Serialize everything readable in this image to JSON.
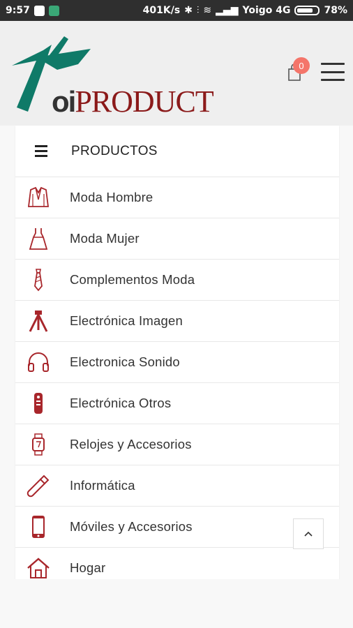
{
  "status_bar": {
    "time": "9:57",
    "net_speed": "401K/s",
    "carrier": "Yoigo 4G",
    "battery": "78%",
    "battery_level": 0.78
  },
  "header": {
    "logo_text_prefix": "oi",
    "logo_text_main": "PRODUCT",
    "cart_count": "0"
  },
  "menu": {
    "title": "PRODUCTOS",
    "items": [
      {
        "label": "Moda Hombre",
        "icon": "suit-jacket-icon"
      },
      {
        "label": "Moda Mujer",
        "icon": "dress-icon"
      },
      {
        "label": "Complementos Moda",
        "icon": "tie-icon"
      },
      {
        "label": "Electrónica Imagen",
        "icon": "tripod-icon"
      },
      {
        "label": "Electronica Sonido",
        "icon": "headphones-icon"
      },
      {
        "label": "Electrónica Otros",
        "icon": "remote-control-icon"
      },
      {
        "label": "Relojes y Accesorios",
        "icon": "watch-icon"
      },
      {
        "label": "Informática",
        "icon": "usb-drive-icon"
      },
      {
        "label": "Móviles y Accesorios",
        "icon": "mobile-phone-icon"
      },
      {
        "label": "Hogar",
        "icon": "house-icon"
      }
    ]
  },
  "colors": {
    "brand_green": "#0f7a68",
    "brand_red": "#8b1a1a",
    "icon_red": "#a8262b",
    "badge": "#f4756a"
  }
}
